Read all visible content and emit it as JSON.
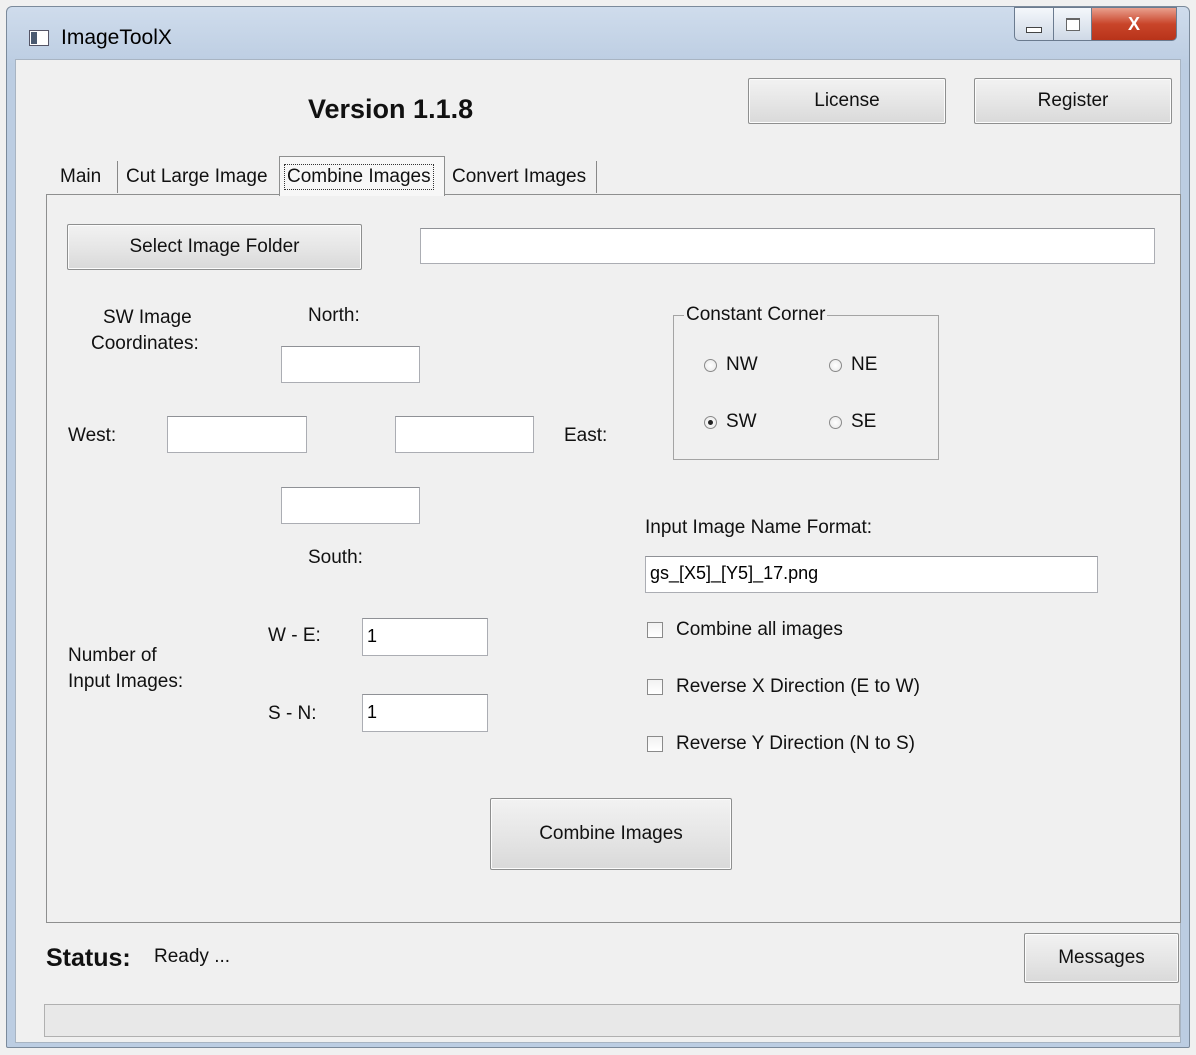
{
  "window": {
    "title": "ImageToolX",
    "close_glyph": "X"
  },
  "header": {
    "version": "Version 1.1.8",
    "license_button": "License",
    "register_button": "Register"
  },
  "tabs": [
    {
      "label": "Main"
    },
    {
      "label": "Cut Large Image"
    },
    {
      "label": "Combine Images",
      "active": true
    },
    {
      "label": "Convert Images"
    }
  ],
  "combine": {
    "select_folder_button": "Select Image Folder",
    "folder_path": "",
    "coords_label_line1": "SW Image",
    "coords_label_line2": "Coordinates:",
    "north_label": "North:",
    "south_label": "South:",
    "west_label": "West:",
    "east_label": "East:",
    "north_value": "",
    "south_value": "",
    "west_value": "",
    "east_value": "",
    "constant_corner": {
      "legend": "Constant Corner",
      "options": [
        "NW",
        "NE",
        "SW",
        "SE"
      ],
      "selected": "SW"
    },
    "name_format_label": "Input Image Name Format:",
    "name_format_value": "gs_[X5]_[Y5]_17.png",
    "num_images_line1": "Number of",
    "num_images_line2": "Input Images:",
    "we_label": "W - E:",
    "sn_label": "S - N:",
    "we_value": "1",
    "sn_value": "1",
    "checkboxes": {
      "combine_all": "Combine all images",
      "reverse_x": "Reverse X Direction (E to W)",
      "reverse_y": "Reverse Y Direction (N to S)"
    },
    "combine_button": "Combine Images"
  },
  "status": {
    "label": "Status:",
    "text": "Ready ...",
    "messages_button": "Messages",
    "progress": 0
  }
}
